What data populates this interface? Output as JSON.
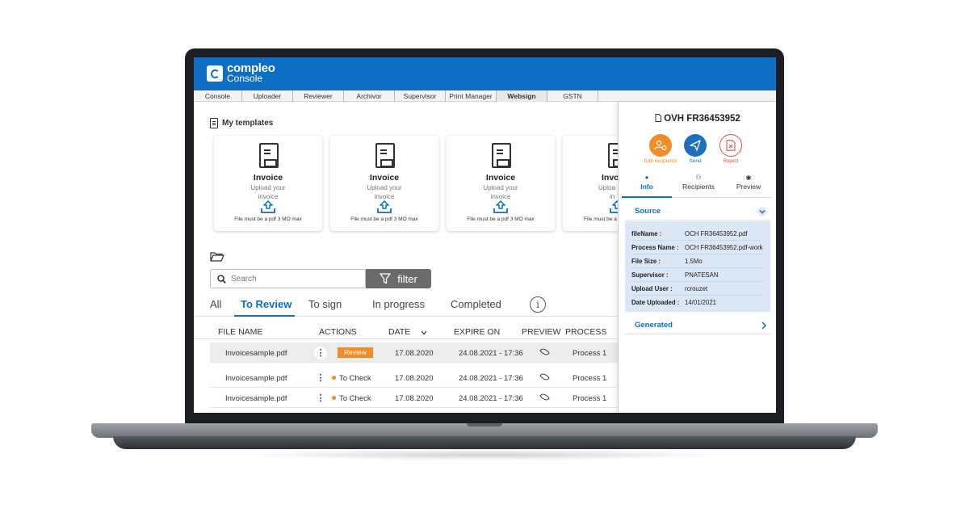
{
  "app": {
    "logo_line1": "compleo",
    "logo_line2": "Console"
  },
  "topnav": [
    {
      "label": "Console",
      "active": false
    },
    {
      "label": "Uploader",
      "active": false
    },
    {
      "label": "Reviewer",
      "active": false
    },
    {
      "label": "Archivor",
      "active": false
    },
    {
      "label": "Supervisor",
      "active": false
    },
    {
      "label": "Print Manager",
      "active": false
    },
    {
      "label": "Websign",
      "active": true
    },
    {
      "label": "GSTN",
      "active": false
    }
  ],
  "templates": {
    "title": "My templates",
    "cards": [
      {
        "title": "Invoice",
        "sub1": "Upload your",
        "sub2": "invoice",
        "note": "File must be a pdf 3 MO max"
      },
      {
        "title": "Invoice",
        "sub1": "Upload your",
        "sub2": "invoice",
        "note": "File must be a pdf 3 MO max"
      },
      {
        "title": "Invoice",
        "sub1": "Upload your",
        "sub2": "invoice",
        "note": "File must be a pdf 3 MO max"
      },
      {
        "title": "Invo",
        "sub1": "Uploa",
        "sub2": "in",
        "note": "File must be a"
      }
    ]
  },
  "search": {
    "placeholder": "Search",
    "filter_label": "filter"
  },
  "status_tabs": {
    "all": "All",
    "to_review": "To Review",
    "to_sign": "To sign",
    "in_progress": "In progress",
    "completed": "Completed"
  },
  "table": {
    "headers": {
      "file_name": "FILE NAME",
      "actions": "ACTIONS",
      "date": "DATE",
      "expire_on": "EXPIRE ON",
      "preview": "PREVIEW",
      "process": "PROCESS"
    },
    "rows": [
      {
        "file": "Invoicesample.pdf",
        "action": "Review",
        "date": "17.08.2020",
        "expire": "24.08.2021 - 17:36",
        "process": "Process 1"
      },
      {
        "file": "Invoicesample.pdf",
        "action": "To Check",
        "date": "17.08.2020",
        "expire": "24.08.2021 - 17:36",
        "process": "Process 1"
      },
      {
        "file": "Invoicesample.pdf",
        "action": "To Check",
        "date": "17.08.2020",
        "expire": "24.08.2021 - 17:36",
        "process": "Process 1"
      }
    ]
  },
  "panel": {
    "title": "OVH FR36453952",
    "actions": {
      "edit": "Edit recipients",
      "send": "Send",
      "reject": "Reject"
    },
    "tabs": {
      "info": "Info",
      "recipients": "Recipients",
      "preview": "Preview"
    },
    "source_label": "Source",
    "generated_label": "Generated",
    "fields": [
      {
        "key": "fileName :",
        "value": "OCH FR36453952.pdf"
      },
      {
        "key": "Process Name :",
        "value": "OCH FR36453952.pdf-work"
      },
      {
        "key": "File Size :",
        "value": "1.5Mo"
      },
      {
        "key": "Supervisor :",
        "value": "PNATESAN"
      },
      {
        "key": "Upload User :",
        "value": "rcrouzet"
      },
      {
        "key": "Date Uploaded :",
        "value": "14/01/2021"
      }
    ]
  },
  "colors": {
    "brand_blue": "#0d6fc4",
    "accent_orange": "#f28c28",
    "send_blue": "#1f6fbf",
    "reject_red": "#d9534f"
  }
}
